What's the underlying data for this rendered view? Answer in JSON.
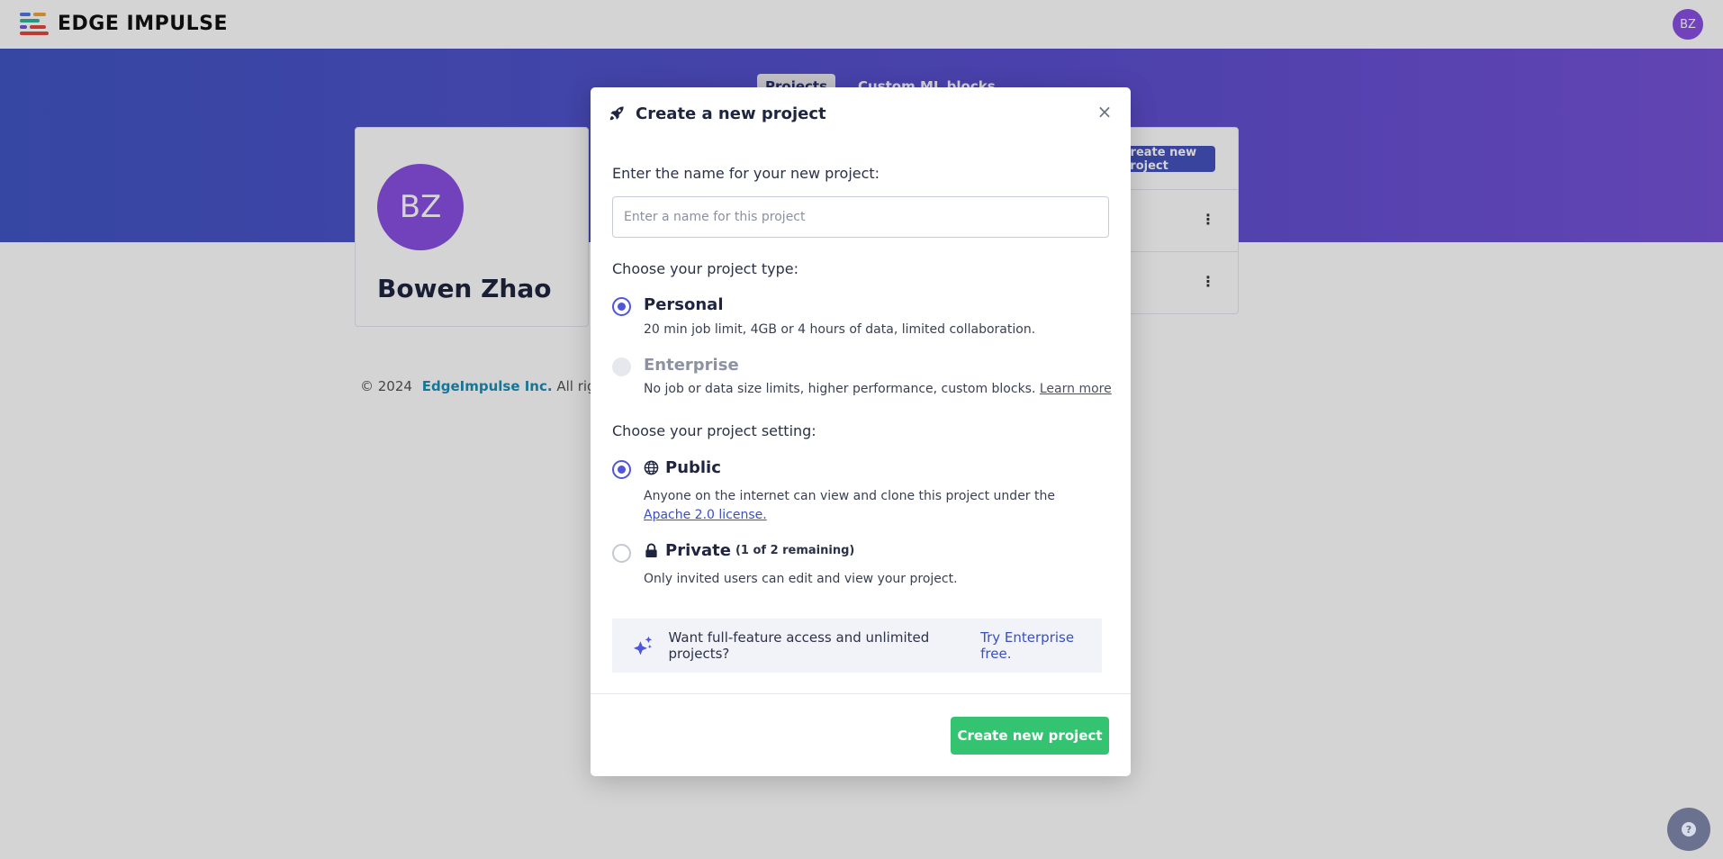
{
  "topbar": {
    "logo_text": "EDGE IMPULSE",
    "avatar_initials": "BZ"
  },
  "hero": {
    "tabs": [
      {
        "label": "Projects",
        "active": true
      },
      {
        "label": "Custom ML blocks",
        "active": false
      }
    ]
  },
  "profile": {
    "initials": "BZ",
    "name": "Bowen Zhao"
  },
  "projects_panel": {
    "create_button_label": "Create new project"
  },
  "footer": {
    "copyright": "© 2024",
    "company_link": "EdgeImpulse Inc.",
    "rights": "All rights rese"
  },
  "modal": {
    "title": "Create a new project",
    "close_label": "×",
    "name_prompt": "Enter the name for your new project:",
    "name_input": {
      "value": "",
      "placeholder": "Enter a name for this project"
    },
    "type_prompt": "Choose your project type:",
    "type_options": [
      {
        "title": "Personal",
        "description": "20 min job limit, 4GB or 4 hours of data, limited collaboration.",
        "selected": true,
        "disabled": false
      },
      {
        "title": "Enterprise",
        "description": "No job or data size limits, higher performance, custom blocks.",
        "link": "Learn more",
        "selected": false,
        "disabled": true
      }
    ],
    "setting_prompt": "Choose your project setting:",
    "setting_options": [
      {
        "title": "Public",
        "icon": "globe-icon",
        "description": "Anyone on the internet can view and clone this project under the",
        "link": "Apache 2.0 license.",
        "selected": true
      },
      {
        "title": "Private",
        "icon": "lock-icon",
        "note": "(1 of 2 remaining)",
        "description": "Only invited users can edit and view your project.",
        "selected": false
      }
    ],
    "promo": {
      "icon": "sparkle-icon",
      "text": "Want full-feature access and unlimited projects?",
      "link": "Try Enterprise free."
    },
    "submit_label": "Create new project"
  },
  "help": {
    "icon": "question-icon",
    "label": "?"
  },
  "colors": {
    "accent": "#4f57d8",
    "brand_gradient_start": "#4256c4",
    "brand_gradient_end": "#7652d8",
    "success": "#34c471",
    "avatar": "#8a4fe3"
  }
}
